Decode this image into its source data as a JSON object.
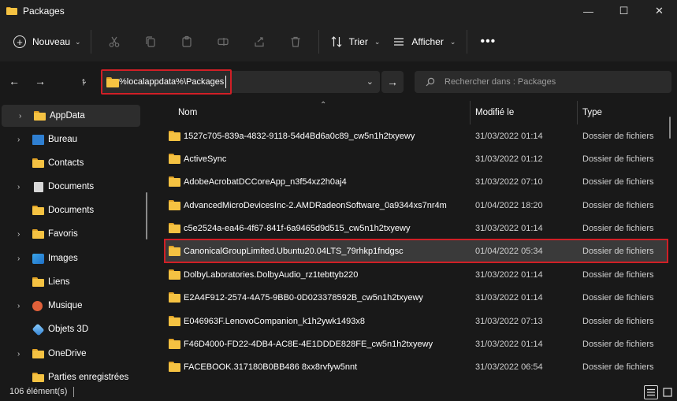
{
  "window": {
    "title": "Packages",
    "controls": {
      "minimize": "—",
      "maximize": "☐",
      "close": "✕"
    }
  },
  "toolbar": {
    "new_label": "Nouveau",
    "sort_label": "Trier",
    "view_label": "Afficher",
    "more": "•••"
  },
  "address": {
    "path": "%localappdata%\\Packages",
    "search_placeholder": "Rechercher dans : Packages"
  },
  "sidebar": {
    "items": [
      {
        "label": "AppData",
        "icon": "folder-icon",
        "expandable": true,
        "selected": true
      },
      {
        "label": "Bureau",
        "icon": "desktop-icon",
        "expandable": true
      },
      {
        "label": "Contacts",
        "icon": "folder-icon",
        "expandable": false
      },
      {
        "label": "Documents",
        "icon": "documents-icon",
        "expandable": true
      },
      {
        "label": "Documents",
        "icon": "folder-icon",
        "expandable": false
      },
      {
        "label": "Favoris",
        "icon": "folder-icon",
        "expandable": true
      },
      {
        "label": "Images",
        "icon": "images-icon",
        "expandable": true
      },
      {
        "label": "Liens",
        "icon": "folder-icon",
        "expandable": false
      },
      {
        "label": "Musique",
        "icon": "music-icon",
        "expandable": true
      },
      {
        "label": "Objets 3D",
        "icon": "objects-3d-icon",
        "expandable": false
      },
      {
        "label": "OneDrive",
        "icon": "folder-icon",
        "expandable": true
      },
      {
        "label": "Parties enregistrées",
        "icon": "folder-icon",
        "expandable": false
      }
    ]
  },
  "columns": {
    "name": "Nom",
    "modified": "Modifié le",
    "type": "Type"
  },
  "files": [
    {
      "name": "1527c705-839a-4832-9118-54d4Bd6a0c89_cw5n1h2txyewy",
      "date": "31/03/2022 01:14",
      "type": "Dossier de fichiers"
    },
    {
      "name": "ActiveSync",
      "date": "31/03/2022 01:12",
      "type": "Dossier de fichiers"
    },
    {
      "name": "AdobeAcrobatDCCoreApp_n3f54xz2h0aj4",
      "date": "31/03/2022 07:10",
      "type": "Dossier de fichiers"
    },
    {
      "name": "AdvancedMicroDevicesInc-2.AMDRadeonSoftware_0a9344xs7nr4m",
      "date": "01/04/2022 18:20",
      "type": "Dossier de fichiers"
    },
    {
      "name": "c5e2524a-ea46-4f67-841f-6a9465d9d515_cw5n1h2txyewy",
      "date": "31/03/2022 01:14",
      "type": "Dossier de fichiers"
    },
    {
      "name": "CanonicalGroupLimited.Ubuntu20.04LTS_79rhkp1fndgsc",
      "date": "01/04/2022 05:34",
      "type": "Dossier de fichiers",
      "highlighted": true
    },
    {
      "name": "DolbyLaboratories.DolbyAudio_rz1tebttyb220",
      "date": "31/03/2022 01:14",
      "type": "Dossier de fichiers"
    },
    {
      "name": "E2A4F912-2574-4A75-9BB0-0D023378592B_cw5n1h2txyewy",
      "date": "31/03/2022 01:14",
      "type": "Dossier de fichiers"
    },
    {
      "name": "E046963F.LenovoCompanion_k1h2ywk1493x8",
      "date": "31/03/2022 07:13",
      "type": "Dossier de fichiers"
    },
    {
      "name": "F46D4000-FD22-4DB4-AC8E-4E1DDDE828FE_cw5n1h2txyewy",
      "date": "31/03/2022 01:14",
      "type": "Dossier de fichiers"
    },
    {
      "name": "FACEBOOK.317180B0BB486 8xx8rvfyw5nnt",
      "date": "31/03/2022 06:54",
      "type": "Dossier de fichiers"
    }
  ],
  "status": {
    "count": "106 élément(s)"
  },
  "colors": {
    "highlight_border": "#d11f26",
    "folder": "#f5c242",
    "background": "#191919"
  }
}
